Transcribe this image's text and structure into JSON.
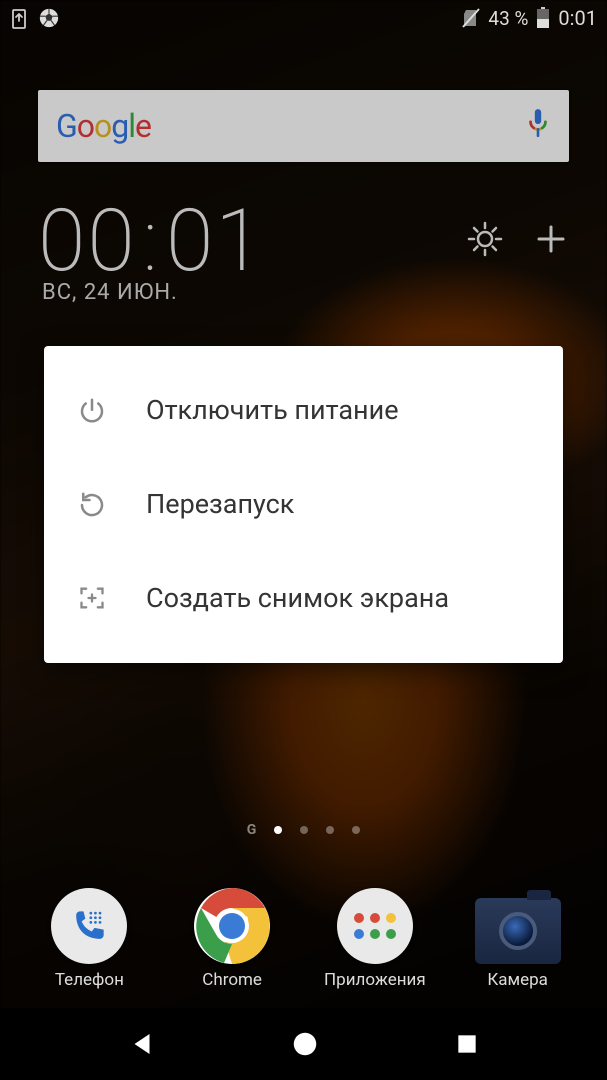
{
  "status": {
    "battery_text": "43 %",
    "time": "0:01"
  },
  "search": {
    "logo": {
      "g1": "G",
      "g2": "o",
      "g3": "o",
      "g4": "g",
      "g5": "l",
      "g6": "e"
    }
  },
  "clock": {
    "hours": "00",
    "minutes": "01",
    "date": "ВС, 24 ИЮН."
  },
  "power_menu": {
    "power_off": "Отключить питание",
    "restart": "Перезапуск",
    "screenshot": "Создать снимок экрана"
  },
  "dock": {
    "phone": "Телефон",
    "chrome": "Chrome",
    "apps": "Приложения",
    "camera": "Камера"
  }
}
